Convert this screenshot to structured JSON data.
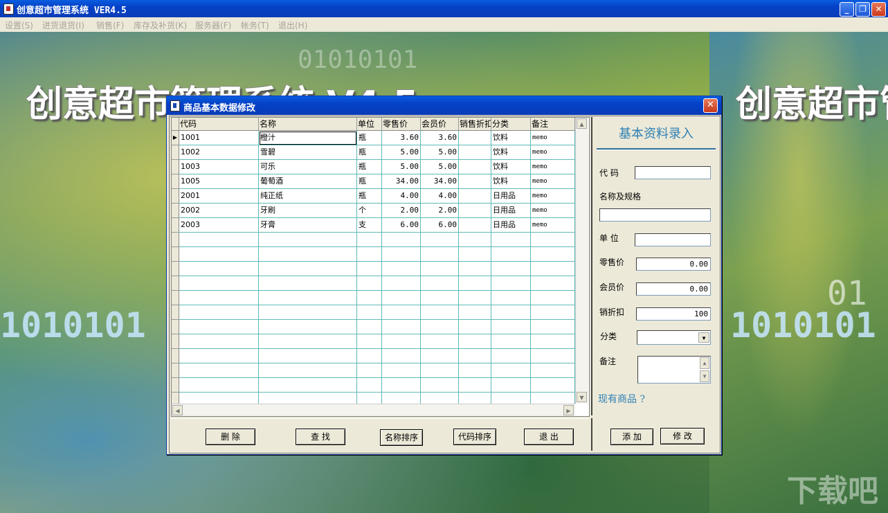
{
  "window": {
    "title": "创意超市管理系统 VER4.5"
  },
  "menu": [
    "设置(S)",
    "进货退货(I)",
    "销售(F)",
    "库存及补货(K)",
    "服务器(F)",
    "帐务(T)",
    "退出(H)"
  ],
  "background": {
    "banner_text": "创意超市管理系统 V4.5",
    "binary": "01010101",
    "binary2": "1010101",
    "binary3": "01",
    "watermark": "下载吧"
  },
  "dialog": {
    "title": "商品基本数据修改",
    "columns": [
      "代码",
      "名称",
      "单位",
      "零售价",
      "会员价",
      "销售折扣",
      "分类",
      "备注"
    ],
    "rows": [
      [
        "1001",
        "橙汁",
        "瓶",
        "3.60",
        "3.60",
        "",
        "饮料",
        "memo"
      ],
      [
        "1002",
        "雪碧",
        "瓶",
        "5.00",
        "5.00",
        "",
        "饮料",
        "memo"
      ],
      [
        "1003",
        "可乐",
        "瓶",
        "5.00",
        "5.00",
        "",
        "饮料",
        "memo"
      ],
      [
        "1005",
        "葡萄酒",
        "瓶",
        "34.00",
        "34.00",
        "",
        "饮料",
        "memo"
      ],
      [
        "2001",
        "纯正纸",
        "瓶",
        "4.00",
        "4.00",
        "",
        "日用品",
        "memo"
      ],
      [
        "2002",
        "牙刷",
        "个",
        "2.00",
        "2.00",
        "",
        "日用品",
        "memo"
      ],
      [
        "2003",
        "牙膏",
        "支",
        "6.00",
        "6.00",
        "",
        "日用品",
        "memo"
      ]
    ],
    "buttons": {
      "delete": "删 除",
      "find": "查 找",
      "sort_name": "名称排序",
      "sort_code": "代码排序",
      "exit": "退 出"
    }
  },
  "form": {
    "title": "基本资料录入",
    "code_label": "代 码",
    "name_label": "名称及规格",
    "unit_label": "单 位",
    "retail_label": "零售价",
    "retail_value": "0.00",
    "member_label": "会员价",
    "member_value": "0.00",
    "discount_label": "销折扣",
    "discount_value": "100",
    "category_label": "分类",
    "note_label": "备注",
    "existing_link": "现有商品 ?",
    "add_button": "添 加",
    "modify_button": "修 改"
  },
  "colors": {
    "titlebar": "#0441c7",
    "grid_line": "#5fb8b8",
    "accent_text": "#2e7fb3"
  }
}
